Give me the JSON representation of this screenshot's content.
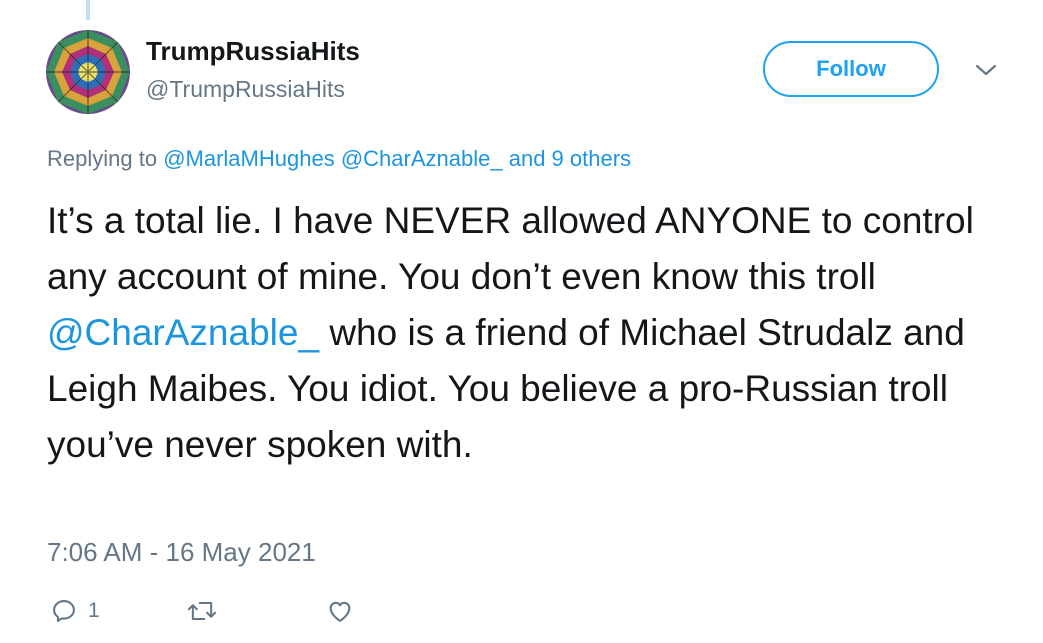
{
  "author": {
    "display_name": "TrumpRussiaHits",
    "handle": "@TrumpRussiaHits",
    "avatar_icon": "kaleidoscope-avatar"
  },
  "follow_button": {
    "label": "Follow"
  },
  "replying": {
    "prefix": "Replying to",
    "mentions": [
      "@MarlaMHughes",
      "@CharAznable_"
    ],
    "suffix": "and 9 others"
  },
  "tweet": {
    "text_before": "It’s a total lie. I have NEVER allowed ANYONE to control any account of mine. You don’t even know this troll",
    "mention": "@CharAznable_",
    "text_after": "who is a friend of Michael Strudalz and Leigh Maibes. You idiot. You believe a pro-Russian troll you’ve never spoken with."
  },
  "timestamp": "7:06 AM - 16 May 2021",
  "actions": {
    "reply_count": "1",
    "icons": [
      "reply-icon",
      "retweet-icon",
      "like-icon"
    ]
  },
  "colors": {
    "accent": "#1da1f2",
    "link": "#1b95e0",
    "muted": "#657786",
    "text": "#14171a"
  }
}
